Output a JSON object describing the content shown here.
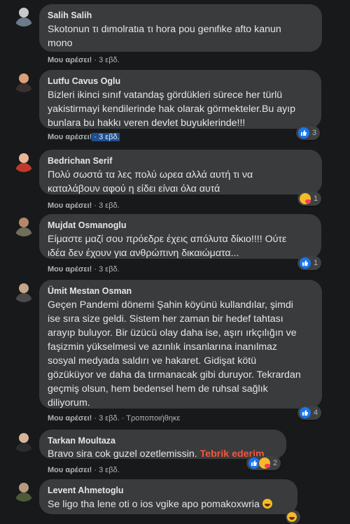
{
  "comments": [
    {
      "author": "Salih Salih",
      "lines": [
        "Skotonun τι dιmolratιa τι hora pou genιfιke afto kanun",
        "mono"
      ],
      "like": "Μου αρέσει!",
      "time": "3 εβδ.",
      "avatar_colors": [
        "#c9c9c9",
        "#6b7b8c"
      ]
    },
    {
      "author": "Lutfu Cavus Oglu",
      "lines": [
        "Bizleri ikinci sınıf vatandaş gördükleri sürece her türlü",
        "yakistirmayi kendilerinde hak olarak görmekteler.Bu ayıp",
        "bunlara bu hakkı veren devlet buyuklerinde!!!"
      ],
      "like": "Μου αρέσει!",
      "time": "3 εβδ.",
      "reaction_count": "3",
      "avatar_colors": [
        "#d9a07a",
        "#3a3030"
      ]
    },
    {
      "author": "Bedrichan Serif",
      "lines": [
        "Πολύ σωστά τα λες πολύ ωρεα αλλά αυτή τι να",
        "καταλάβουν αφού η είδει είναι όλα αυτά"
      ],
      "like": "Μου αρέσει!",
      "time": "3 εβδ.",
      "reaction_count": "1",
      "avatar_colors": [
        "#e8b896",
        "#c0392b"
      ]
    },
    {
      "author": "Mujdat Osmanoglu",
      "lines": [
        "Είμαστε μαζί σου πρόεδρε έχεις απόλυτα δίκιο!!!! Ούτε",
        "ιδέα δεν έχουν για ανθρώπινη δικαιώματα..."
      ],
      "like": "Μου αρέσει!",
      "time": "3 εβδ.",
      "reaction_count": "1",
      "avatar_colors": [
        "#b5876a",
        "#6f6f5a"
      ]
    },
    {
      "author": "Ümit Mestan Osman",
      "lines": [
        "Geçen Pandemi dönemi Şahin köyünü kullandılar, şimdi",
        "ise sıra size geldi. Sistem her zaman bir hedef tahtası",
        "arayıp buluyor. Bir üzücü olay daha ise, aşırı ırkçılığın ve",
        "faşizmin yükselmesi ve azınlık insanlarına inanılmaz",
        "sosyal medyada saldırı ve hakaret. Gidişat kötü",
        "gözüküyor ve daha da tırmanacak gibi duruyor. Tekrardan",
        "geçmiş olsun, hem bedensel hem de ruhsal sağlık",
        "diliyorum."
      ],
      "like": "Μου αρέσει!",
      "time": "3 εβδ.",
      "edited": "Τροποποιήθηκε",
      "reaction_count": "4",
      "avatar_colors": [
        "#c4a58a",
        "#4a4a4a"
      ]
    },
    {
      "author": "Tarkan Moultaza",
      "text_plain": "Bravo sira cok guzel ozetlemissin.",
      "text_highlight": "Tebrik ederim",
      "like": "Μου αρέσει!",
      "time": "3 εβδ.",
      "reaction_count": "2",
      "avatar_colors": [
        "#d8b59a",
        "#2c2c2c"
      ]
    },
    {
      "author": "Levent Ahmetoglu",
      "text_plain": "Se ligo tha lene oti o ios vgike apo pomakoxwria",
      "avatar_colors": [
        "#b89a80",
        "#4c5a3a"
      ]
    }
  ],
  "thumbs_up_glyph": "👍"
}
